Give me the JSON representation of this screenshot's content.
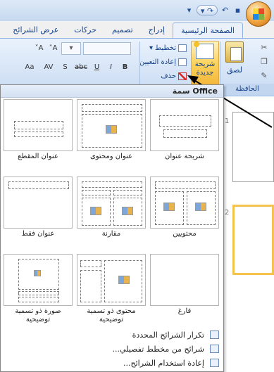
{
  "tabs": [
    "الصفحة الرئيسية",
    "إدراج",
    "تصميم",
    "حركات",
    "عرض الشرائح"
  ],
  "ribbon": {
    "paste": "لصق",
    "clipboard_group": "الحافظة",
    "new_slide_line1": "شريحة",
    "new_slide_line2": "جديدة",
    "layout": "تخطيط",
    "reset": "إعادة التعيين",
    "delete": "حذف",
    "font_size_value": "",
    "bold": "B",
    "italic": "I",
    "underline": "U",
    "strike": "abc",
    "shadow": "S",
    "spacing": "AV",
    "change_case": "Aa",
    "grow": "A",
    "shrink": "A"
  },
  "panel": {
    "title": "سمة Office",
    "layouts": [
      {
        "label": "شريحة عنوان"
      },
      {
        "label": "عنوان ومحتوى"
      },
      {
        "label": "عنوان المقطع"
      },
      {
        "label": "محتويين"
      },
      {
        "label": "مقارنة"
      },
      {
        "label": "عنوان فقط"
      },
      {
        "label": "فارغ"
      },
      {
        "label_line1": "محتوى ذو تسمية",
        "label_line2": "توضيحية"
      },
      {
        "label_line1": "صورة ذو تسمية",
        "label_line2": "توضيحية"
      }
    ],
    "footer": [
      "تكرار الشرائح المحددة",
      "شرائح من مخطط تفصيلي...",
      "إعادة استخدام الشرائح..."
    ]
  },
  "slides": [
    "1",
    "2"
  ]
}
